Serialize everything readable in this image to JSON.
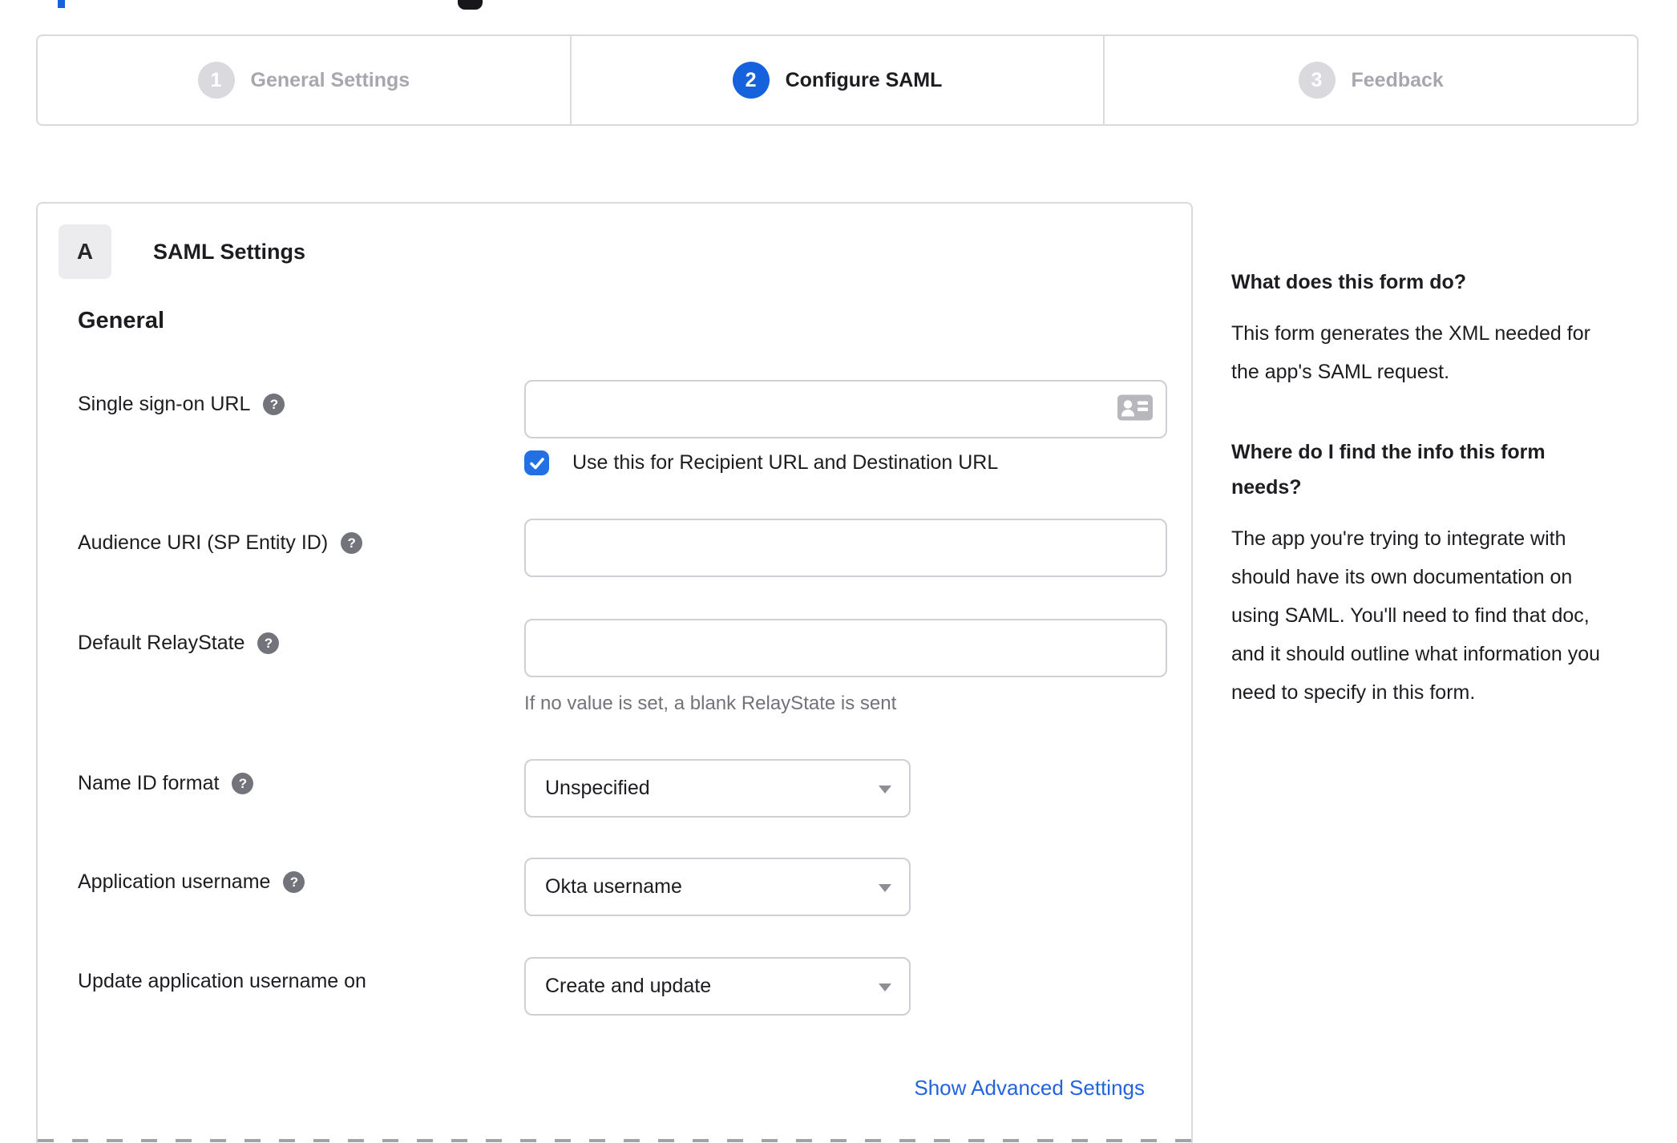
{
  "stepper": {
    "steps": [
      {
        "number": "1",
        "label": "General Settings",
        "state": "inactive"
      },
      {
        "number": "2",
        "label": "Configure SAML",
        "state": "active"
      },
      {
        "number": "3",
        "label": "Feedback",
        "state": "inactive"
      }
    ]
  },
  "panel": {
    "section_badge": "A",
    "section_title": "SAML Settings",
    "group_heading": "General",
    "fields": {
      "sso_url": {
        "label": "Single sign-on URL",
        "value": "",
        "checkbox_label": "Use this for Recipient URL and Destination URL",
        "checkbox_checked": true
      },
      "audience_uri": {
        "label": "Audience URI (SP Entity ID)",
        "value": ""
      },
      "default_relaystate": {
        "label": "Default RelayState",
        "value": "",
        "hint": "If no value is set, a blank RelayState is sent"
      },
      "name_id_format": {
        "label": "Name ID format",
        "value": "Unspecified"
      },
      "application_username": {
        "label": "Application username",
        "value": "Okta username"
      },
      "update_app_username_on": {
        "label": "Update application username on",
        "value": "Create and update"
      }
    },
    "advanced_link": "Show Advanced Settings"
  },
  "sidebar": {
    "sections": [
      {
        "heading": "What does this form do?",
        "body": "This form generates the XML needed for the app's SAML request."
      },
      {
        "heading": "Where do I find the info this form needs?",
        "body": "The app you're trying to integrate with should have its own documentation on using SAML. You'll need to find that doc, and it should outline what information you need to specify in this form."
      }
    ]
  },
  "ui": {
    "help_glyph": "?"
  },
  "colors": {
    "accent_blue": "#1662dd",
    "checkbox_blue": "#2270e4",
    "link_blue": "#2263e0",
    "border_gray": "#d9d9de",
    "inactive_step_gray": "#a7a7af",
    "text_dark": "#1d1d21",
    "hint_gray": "#72727a"
  }
}
